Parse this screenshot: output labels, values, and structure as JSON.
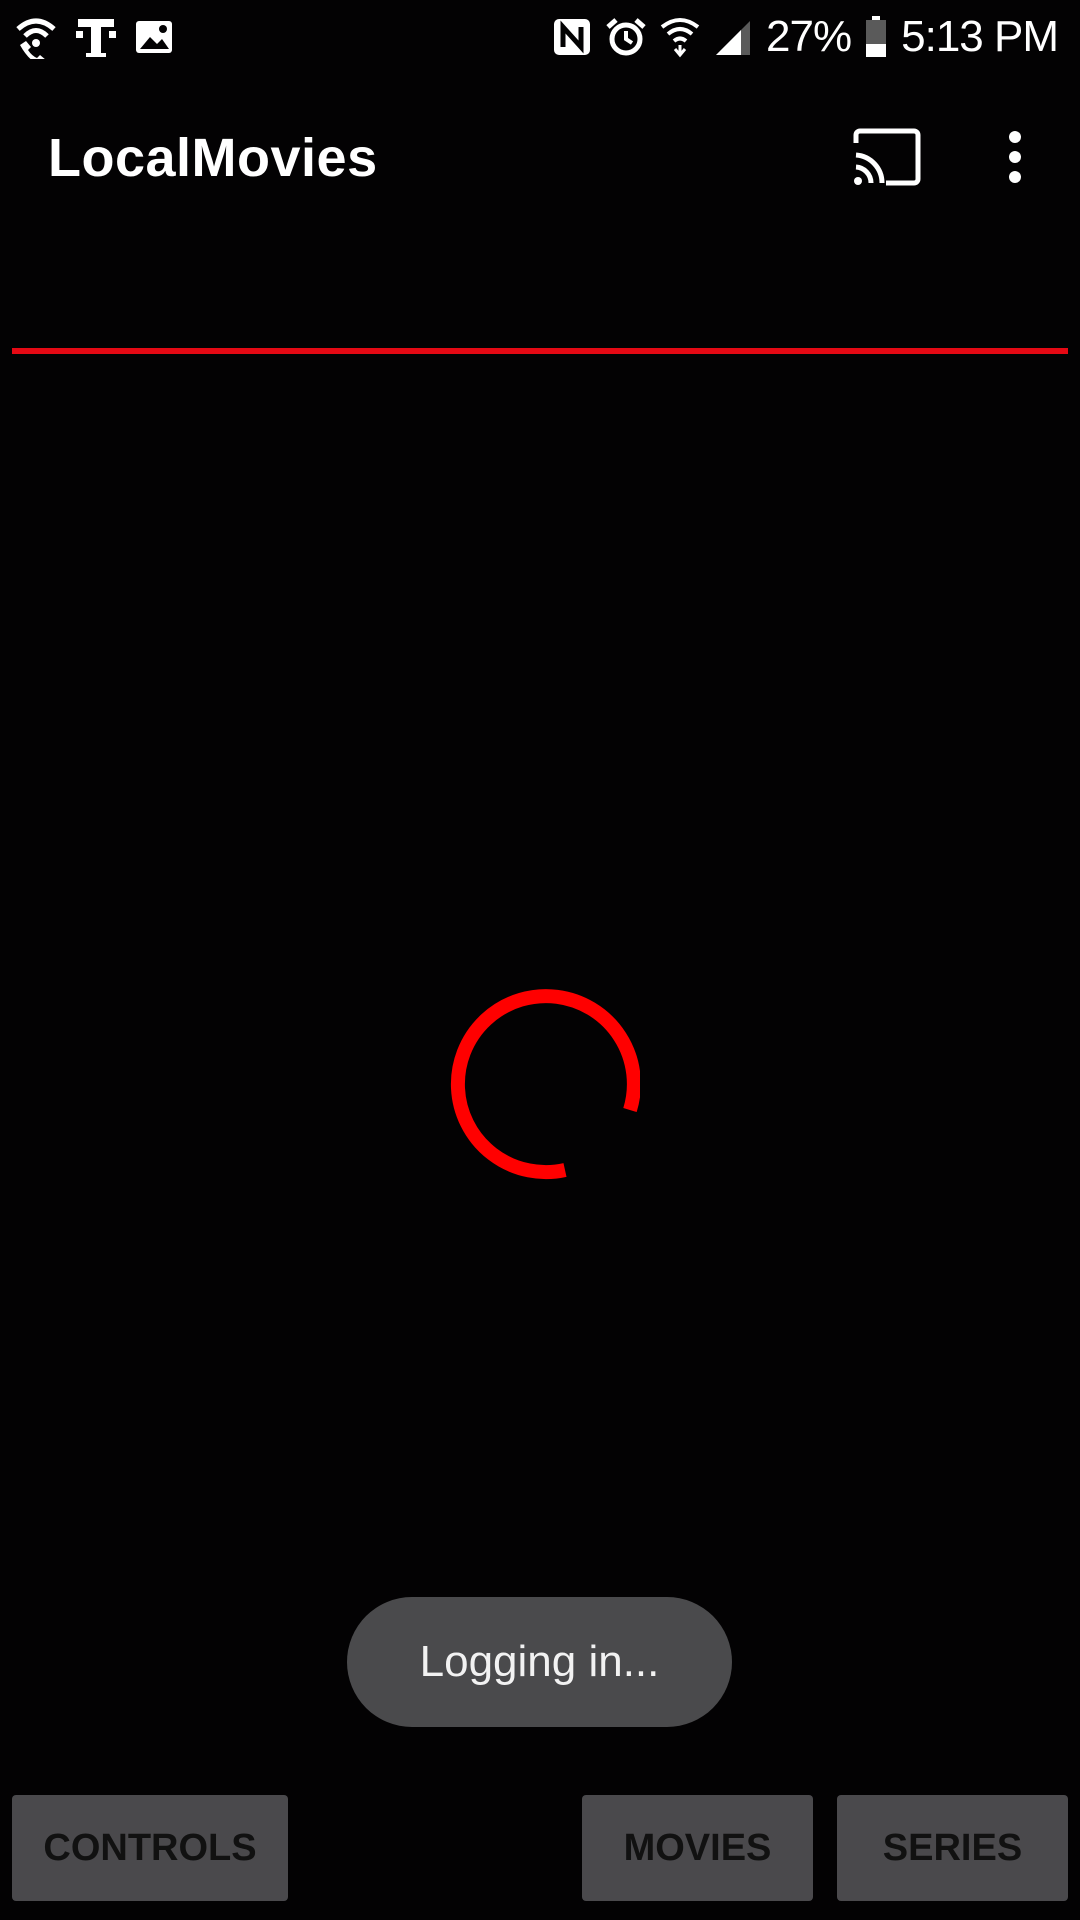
{
  "status_bar": {
    "left_icons": [
      "wifi-calling-icon",
      "t-mobile-icon",
      "image-icon"
    ],
    "right_icons": [
      "nfc-icon",
      "alarm-icon",
      "wifi-icon",
      "signal-icon",
      "battery-icon"
    ],
    "battery_percent": "27%",
    "time": "5:13 PM"
  },
  "app_bar": {
    "title": "LocalMovies",
    "cast_icon": "cast-icon",
    "overflow_icon": "more-vert-icon"
  },
  "accent_color": "#e50914",
  "loading": {
    "state": "spinning"
  },
  "toast": {
    "text": "Logging in..."
  },
  "bottom_buttons": {
    "controls": "CONTROLS",
    "movies": "MOVIES",
    "series": "SERIES"
  }
}
